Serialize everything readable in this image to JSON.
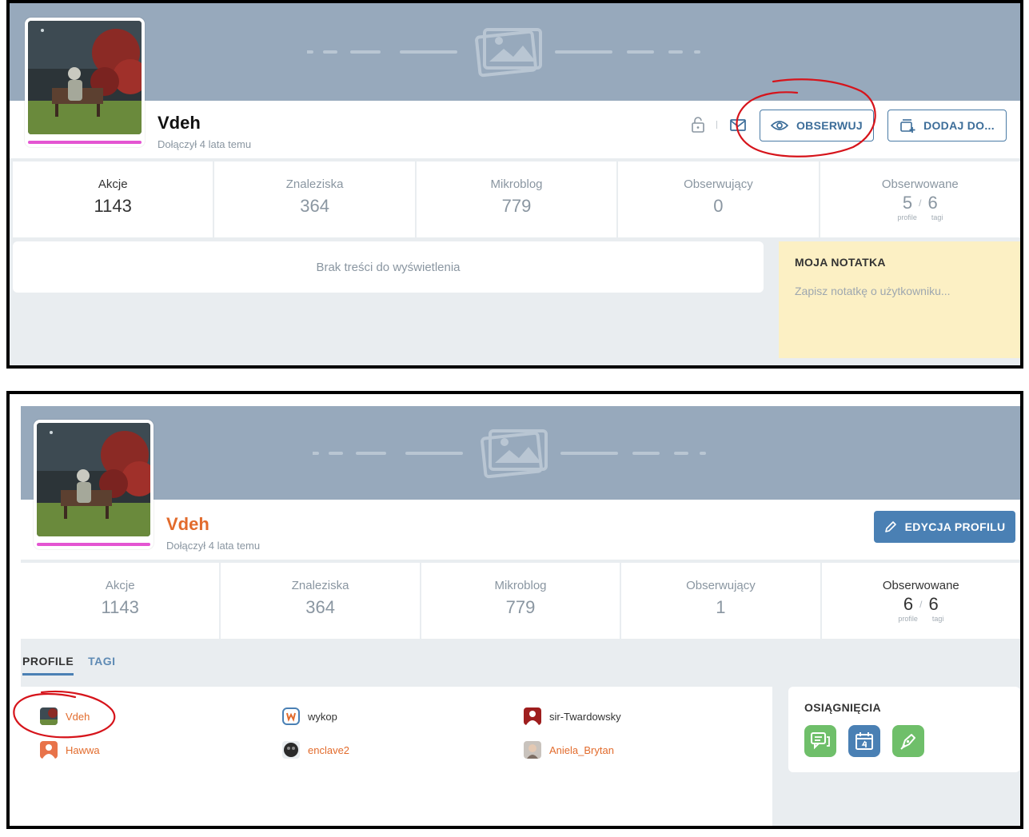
{
  "top": {
    "user": {
      "name": "Vdeh",
      "joined": "Dołączył 4 lata temu"
    },
    "buttons": {
      "follow": "OBSERWUJ",
      "add": "DODAJ DO..."
    },
    "stats": [
      {
        "label": "Akcje",
        "value": "1143"
      },
      {
        "label": "Znaleziska",
        "value": "364"
      },
      {
        "label": "Mikroblog",
        "value": "779"
      },
      {
        "label": "Obserwujący",
        "value": "0"
      }
    ],
    "observed": {
      "label": "Obserwowane",
      "profiles": "5",
      "tags": "6",
      "profiles_sub": "profile",
      "tags_sub": "tagi",
      "slash": "/"
    },
    "empty": "Brak treści do wyświetlenia",
    "note": {
      "title": "MOJA NOTATKA",
      "placeholder": "Zapisz notatkę o użytkowniku..."
    }
  },
  "bottom": {
    "user": {
      "name": "Vdeh",
      "joined": "Dołączył 4 lata temu"
    },
    "buttons": {
      "edit": "EDYCJA PROFILU"
    },
    "stats": [
      {
        "label": "Akcje",
        "value": "1143"
      },
      {
        "label": "Znaleziska",
        "value": "364"
      },
      {
        "label": "Mikroblog",
        "value": "779"
      },
      {
        "label": "Obserwujący",
        "value": "1"
      }
    ],
    "observed": {
      "label": "Obserwowane",
      "profiles": "6",
      "tags": "6",
      "profiles_sub": "profile",
      "tags_sub": "tagi",
      "slash": "/"
    },
    "tabs": {
      "profiles": "PROFILE",
      "tags": "TAGI"
    },
    "followed": [
      {
        "name": "Vdeh",
        "color": "#e26b2c"
      },
      {
        "name": "wykop",
        "color": "#333333"
      },
      {
        "name": "sir-Twardowsky",
        "color": "#333333"
      },
      {
        "name": "Hawwa",
        "color": "#e26b2c"
      },
      {
        "name": "enclave2",
        "color": "#e26b2c"
      },
      {
        "name": "Aniela_Brytan",
        "color": "#e26b2c"
      }
    ],
    "achievements": {
      "title": "OSIĄGNIĘCIA",
      "badge_icons": [
        "comments-icon",
        "calendar-icon",
        "pen-icon"
      ]
    }
  },
  "colors": {
    "accent": "#4a80b4",
    "cover": "#97a9bc",
    "orange_nick": "#e26b2c",
    "note_bg": "#fcf0c4",
    "annotation": "#d6141b"
  }
}
